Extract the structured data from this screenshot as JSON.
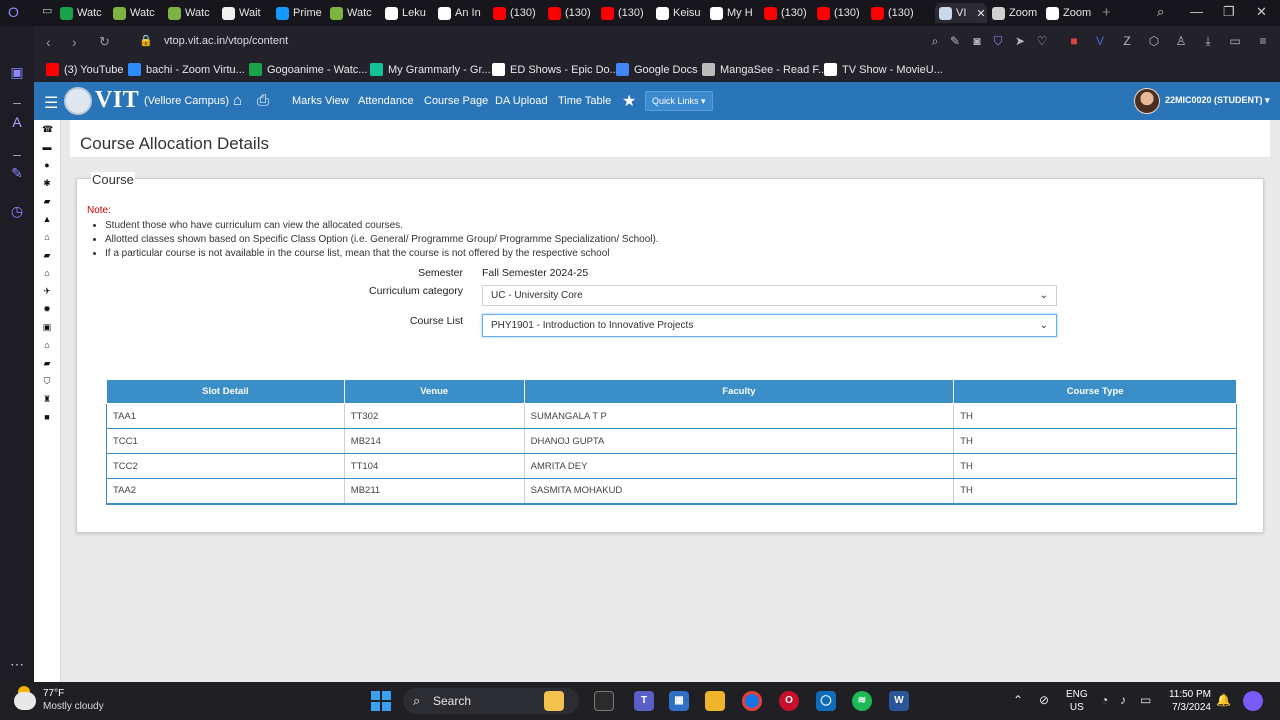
{
  "browser": {
    "tabs": [
      {
        "label": "Watc",
        "color": "#1aa34a",
        "icon": "play-icon"
      },
      {
        "label": "Watc",
        "color": "#7cb342",
        "icon": "grid-icon"
      },
      {
        "label": "Watc",
        "color": "#7cb342",
        "icon": "grid-icon"
      },
      {
        "label": "Wait",
        "color": "#f0f0f0",
        "icon": "doc-icon"
      },
      {
        "label": "Prime",
        "color": "#1399ff",
        "icon": "prime-icon"
      },
      {
        "label": "Watc",
        "color": "#7cb342",
        "icon": "grid-icon"
      },
      {
        "label": "Leku",
        "color": "#ffffff",
        "icon": "link-icon"
      },
      {
        "label": "An In",
        "color": "#ffffff",
        "icon": "link-icon"
      },
      {
        "label": "(130)",
        "color": "#ff0000",
        "icon": "youtube-icon"
      },
      {
        "label": "(130)",
        "color": "#ff0000",
        "icon": "youtube-icon"
      },
      {
        "label": "(130)",
        "color": "#ff0000",
        "icon": "youtube-icon"
      },
      {
        "label": "Keisu",
        "color": "#ffffff",
        "icon": "google-icon"
      },
      {
        "label": "My H",
        "color": "#ffffff",
        "icon": "r-icon"
      },
      {
        "label": "(130)",
        "color": "#ff0000",
        "icon": "youtube-icon"
      },
      {
        "label": "(130)",
        "color": "#ff0000",
        "icon": "youtube-icon"
      },
      {
        "label": "(130)",
        "color": "#ff0000",
        "icon": "youtube-icon"
      },
      {
        "label": "VI",
        "color": "#c9d7e8",
        "icon": "vit-icon"
      },
      {
        "label": "Zoom",
        "color": "#d0d0d0",
        "icon": "book-icon"
      },
      {
        "label": "Zoom",
        "color": "#ffffff",
        "icon": "z-icon"
      }
    ],
    "url": "vtop.vit.ac.in/vtop/content",
    "bookmarks": [
      {
        "label": "(3) YouTube",
        "color": "#ff0000"
      },
      {
        "label": "bachi - Zoom Virtu...",
        "color": "#2d8cff"
      },
      {
        "label": "Gogoanime - Watc...",
        "color": "#1aa34a"
      },
      {
        "label": "My Grammarly - Gr...",
        "color": "#15c39a"
      },
      {
        "label": "ED Shows - Epic Do...",
        "color": "#ffffff"
      },
      {
        "label": "Google Docs",
        "color": "#4285f4"
      },
      {
        "label": "MangaSee - Read F...",
        "color": "#bbbbbb"
      },
      {
        "label": "TV Show - MovieU...",
        "color": "#ffffff"
      }
    ]
  },
  "nav": {
    "logo": "VIT",
    "campus": "(Vellore Campus)",
    "links": [
      "Marks View",
      "Attendance",
      "Course Page",
      "DA Upload",
      "Time Table"
    ],
    "quick_links": "Quick Links ▾",
    "user": "22MIC0020 (STUDENT) ▾"
  },
  "page": {
    "title": "Course Allocation Details",
    "legend": "Course",
    "note_label": "Note:",
    "notes": [
      "Student those who have curriculum can view the allocated courses.",
      "Allotted classes shown based on Specific Class Option (i.e. General/ Programme Group/ Programme Specialization/ School).",
      "If a particular course is not available in the course list, mean that the course is not offered by the respective school"
    ],
    "semester_label": "Semester",
    "semester_value": "Fall Semester 2024-25",
    "category_label": "Curriculum category",
    "category_value": "UC - University Core",
    "course_label": "Course List",
    "course_value": "PHY1901 - Introduction to Innovative Projects"
  },
  "table": {
    "headers": [
      "Slot Detail",
      "Venue",
      "Faculty",
      "Course Type"
    ],
    "rows": [
      [
        "TAA1",
        "TT302",
        "SUMANGALA T P",
        "TH"
      ],
      [
        "TCC1",
        "MB214",
        "DHANOJ GUPTA",
        "TH"
      ],
      [
        "TCC2",
        "TT104",
        "AMRITA DEY",
        "TH"
      ],
      [
        "TAA2",
        "MB211",
        "SASMITA MOHAKUD",
        "TH"
      ]
    ]
  },
  "taskbar": {
    "temp": "77°F",
    "condition": "Mostly cloudy",
    "search": "Search",
    "lang1": "ENG",
    "lang2": "US",
    "time": "11:50 PM",
    "date": "7/3/2024"
  }
}
